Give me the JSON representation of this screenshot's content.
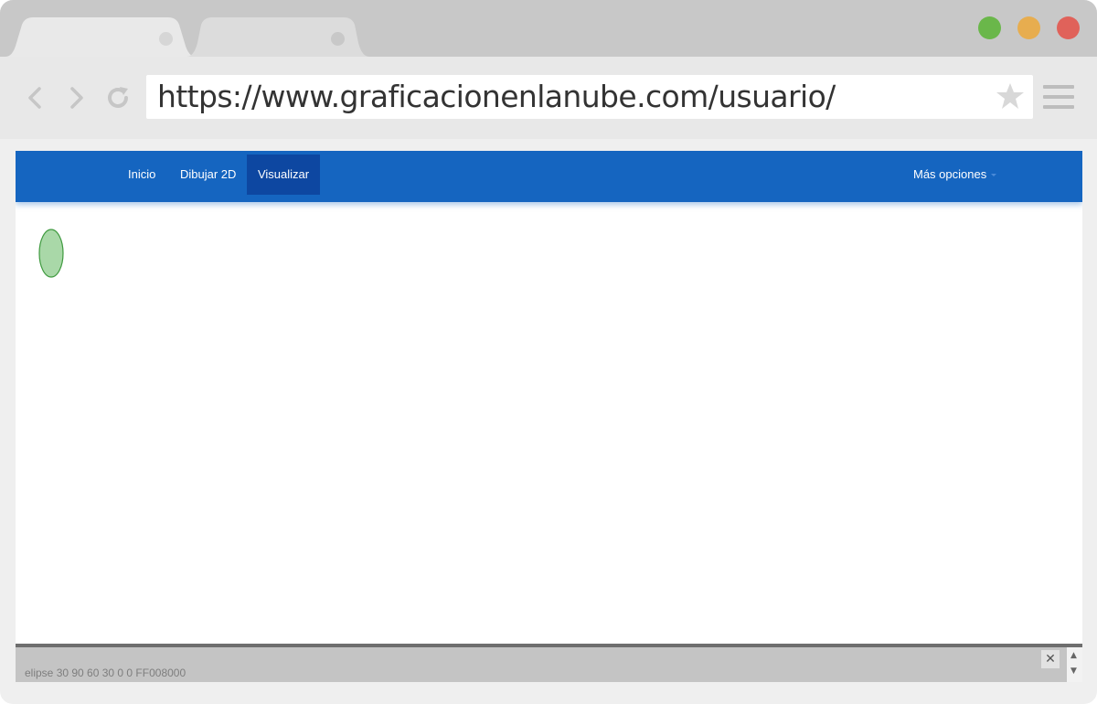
{
  "browser": {
    "url": "https://www.graficacionenlanube.com/usuario/",
    "window_buttons": {
      "green": "#6ab74a",
      "orange": "#e7ad4f",
      "red": "#e0625a"
    }
  },
  "navbar": {
    "color": "#1565c0",
    "active_color": "#0d47a1",
    "items": [
      {
        "label": "Inicio",
        "active": false
      },
      {
        "label": "Dibujar 2D",
        "active": false
      },
      {
        "label": "Visualizar",
        "active": true
      }
    ],
    "more_label": "Más opciones"
  },
  "canvas": {
    "shapes": [
      {
        "type": "ellipse",
        "fill": "#a9d8a8",
        "stroke": "#3f9a3f"
      }
    ]
  },
  "console": {
    "text": "elipse 30 90 60 30 0 0 FF008000"
  }
}
